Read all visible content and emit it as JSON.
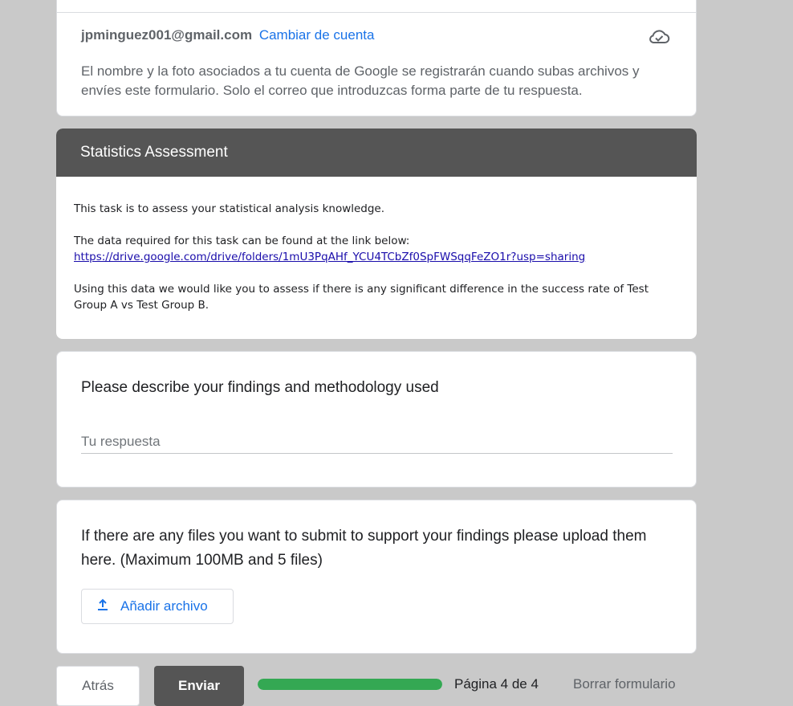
{
  "account": {
    "email": "jpminguez001@gmail.com",
    "switch_label": "Cambiar de cuenta",
    "notice": "El nombre y la foto asociados a tu cuenta de Google se registrarán cuando subas archivos y envíes este formulario. Solo el correo que introduzcas forma parte de tu respuesta.",
    "icon": "cloud-check-icon"
  },
  "section": {
    "title": "Statistics Assessment",
    "intro": "This task is to assess your statistical analysis knowledge.",
    "data_text": "The data required for this task can be found at the link below:",
    "link": "https://drive.google.com/drive/folders/1mU3PqAHf_YCU4TCbZf0SpFWSqqFeZO1r?usp=sharing",
    "instructions": "Using this data we would like you to assess if there is any significant difference in the success rate of Test Group A vs Test Group B."
  },
  "findings_question": {
    "title": "Please describe your findings and methodology used",
    "placeholder": "Tu respuesta",
    "value": ""
  },
  "upload_question": {
    "title": "If there are any files you want to submit to support your findings please upload them here. (Maximum 100MB and 5 files)",
    "button_label": "Añadir archivo",
    "icon": "upload-icon"
  },
  "footer": {
    "back_label": "Atrás",
    "submit_label": "Enviar",
    "progress": 1.0,
    "page_label": "Página 4 de 4",
    "clear_label": "Borrar formulario"
  },
  "colors": {
    "accent": "#1a73e8",
    "header": "#555555",
    "progress": "#34a853",
    "background": "#c9c9c9"
  }
}
